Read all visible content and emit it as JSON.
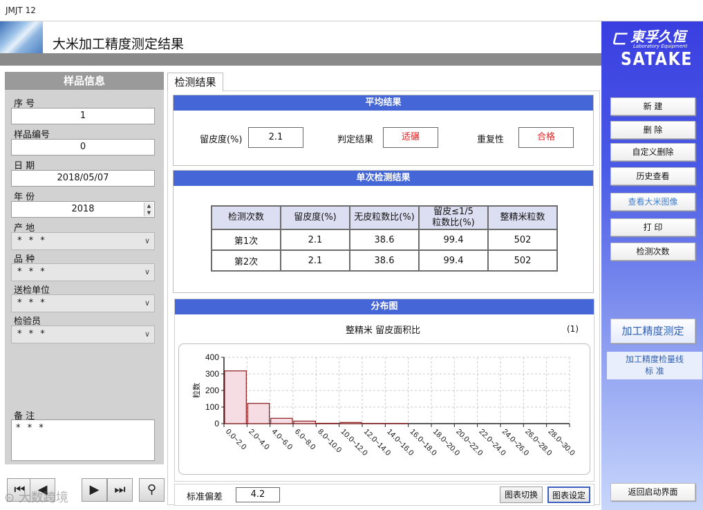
{
  "window": {
    "title": "JMJT 12"
  },
  "header": {
    "title": "大米加工精度测定结果"
  },
  "brand": {
    "cn": "東孚久恒",
    "sub": "Laboratory Equipment",
    "name": "SATAKE"
  },
  "sample_panel": {
    "title": "样品信息",
    "fields": [
      {
        "label": "序 号",
        "value": "1"
      },
      {
        "label": "样品编号",
        "value": "0"
      },
      {
        "label": "日 期",
        "value": "2018/05/07"
      },
      {
        "label": "年 份",
        "value": "2018"
      }
    ],
    "selects": [
      {
        "label": "产 地",
        "value": "* * *"
      },
      {
        "label": "品 种",
        "value": "* * *"
      },
      {
        "label": "送检单位",
        "value": "* * *"
      },
      {
        "label": "检验员",
        "value": "* * *"
      }
    ],
    "memo_label": "备 注",
    "memo_value": "* * *"
  },
  "nav": {
    "first": "⏮",
    "prev": "◀",
    "next": "▶",
    "last": "⏭",
    "search": "⚲"
  },
  "watermark": "⊙ 大数跨境",
  "tab": {
    "label": "检测结果"
  },
  "average": {
    "title": "平均结果",
    "bran_label": "留皮度(%)",
    "bran_value": "2.1",
    "judge_label": "判定结果",
    "judge_value": "适碾",
    "repeat_label": "重复性",
    "repeat_value": "合格"
  },
  "single": {
    "title": "单次检测结果",
    "headers": [
      "检测次数",
      "留皮度(%)",
      "无皮粒数比(%)",
      "留皮≤1/5\n粒数比(%)",
      "整精米粒数"
    ],
    "rows": [
      [
        "第1次",
        "2.1",
        "38.6",
        "99.4",
        "502"
      ],
      [
        "第2次",
        "2.1",
        "38.6",
        "99.4",
        "502"
      ]
    ]
  },
  "distribution": {
    "title": "分布图",
    "chart_title": "整精米 留皮面积比",
    "chart_index": "(1)",
    "std_label": "标准偏差",
    "std_value": "4.2",
    "switch_button": "图表切换",
    "settings_button": "图表设定"
  },
  "right_buttons": {
    "new": "新 建",
    "delete": "删 除",
    "custom_delete": "自定义删除",
    "history": "历史查看",
    "view_image": "查看大米图像",
    "print": "打 印",
    "count": "检测次数",
    "mode": "加工精度测定",
    "standard": "加工精度检量线\n标 准",
    "return": "返回启动界面"
  },
  "chart_data": {
    "type": "bar",
    "title": "整精米 留皮面积比",
    "ylabel": "粒数",
    "xlabel": "",
    "ylim": [
      0,
      400
    ],
    "yticks": [
      0,
      100,
      200,
      300,
      400
    ],
    "categories": [
      "0.0~2.0",
      "2.0~4.0",
      "4.0~6.0",
      "6.0~8.0",
      "8.0~10.0",
      "10.0~12.0",
      "12.0~14.0",
      "14.0~16.0",
      "16.0~18.0",
      "18.0~20.0",
      "20.0~22.0",
      "22.0~24.0",
      "24.0~26.0",
      "26.0~28.0",
      "28.0~30.0"
    ],
    "values": [
      318,
      122,
      32,
      15,
      2,
      7,
      1,
      1,
      0,
      0,
      0,
      0,
      0,
      0,
      0
    ],
    "grid": true,
    "colors": {
      "bar_fill": "#f6dde3",
      "bar_stroke": "#8b1a1a"
    }
  }
}
